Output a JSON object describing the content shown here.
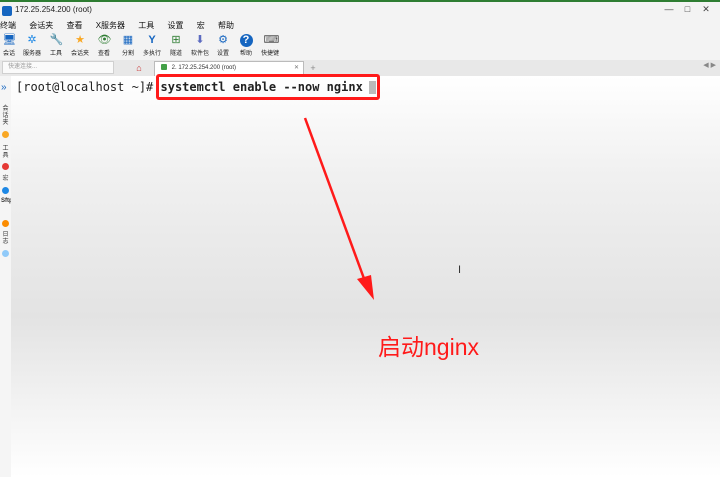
{
  "window": {
    "title": "172.25.254.200 (root)",
    "controls": [
      "—",
      "□",
      "✕"
    ]
  },
  "menu": [
    "终端",
    "会话夹",
    "查看",
    "X服务器",
    "工具",
    "设置",
    "宏",
    "帮助"
  ],
  "toolbar": [
    {
      "label": "会话",
      "icon": "monitor-icon",
      "glyph": "🖥"
    },
    {
      "label": "服务器",
      "icon": "network-icon",
      "glyph": "✲"
    },
    {
      "label": "工具",
      "icon": "tools-icon",
      "glyph": "🔧"
    },
    {
      "label": "会话夹",
      "icon": "star-icon",
      "glyph": "★"
    },
    {
      "label": "查看",
      "icon": "view-icon",
      "glyph": "👁"
    },
    {
      "label": "分割",
      "icon": "split-icon",
      "glyph": "▦"
    },
    {
      "label": "多执行",
      "icon": "fork-icon",
      "glyph": "Y"
    },
    {
      "label": "隧道",
      "icon": "tunnel-icon",
      "glyph": "⊞"
    },
    {
      "label": "软件包",
      "icon": "package-icon",
      "glyph": "⬇"
    },
    {
      "label": "设置",
      "icon": "gear-icon",
      "glyph": "⚙"
    },
    {
      "label": "帮助",
      "icon": "help-icon",
      "glyph": "?"
    },
    {
      "label": "快捷键",
      "icon": "keyboard-icon",
      "glyph": "⌨"
    }
  ],
  "tabs": {
    "quick_connect_placeholder": "快速连接...",
    "active_tab": "2. 172.25.254.200 (root)",
    "close": "✕",
    "plus": "+"
  },
  "sidebar": {
    "labels": [
      "会话夹",
      "工具",
      "宏",
      "Sftp",
      "日志"
    ]
  },
  "terminal": {
    "prompt": "[root@localhost ~]# ",
    "command": "systemctl enable --now nginx"
  },
  "annotation": {
    "text": "启动nginx",
    "color": "#ff1a1a"
  },
  "colors": {
    "accent": "#ff1a1a",
    "brand": "#1565c0"
  }
}
